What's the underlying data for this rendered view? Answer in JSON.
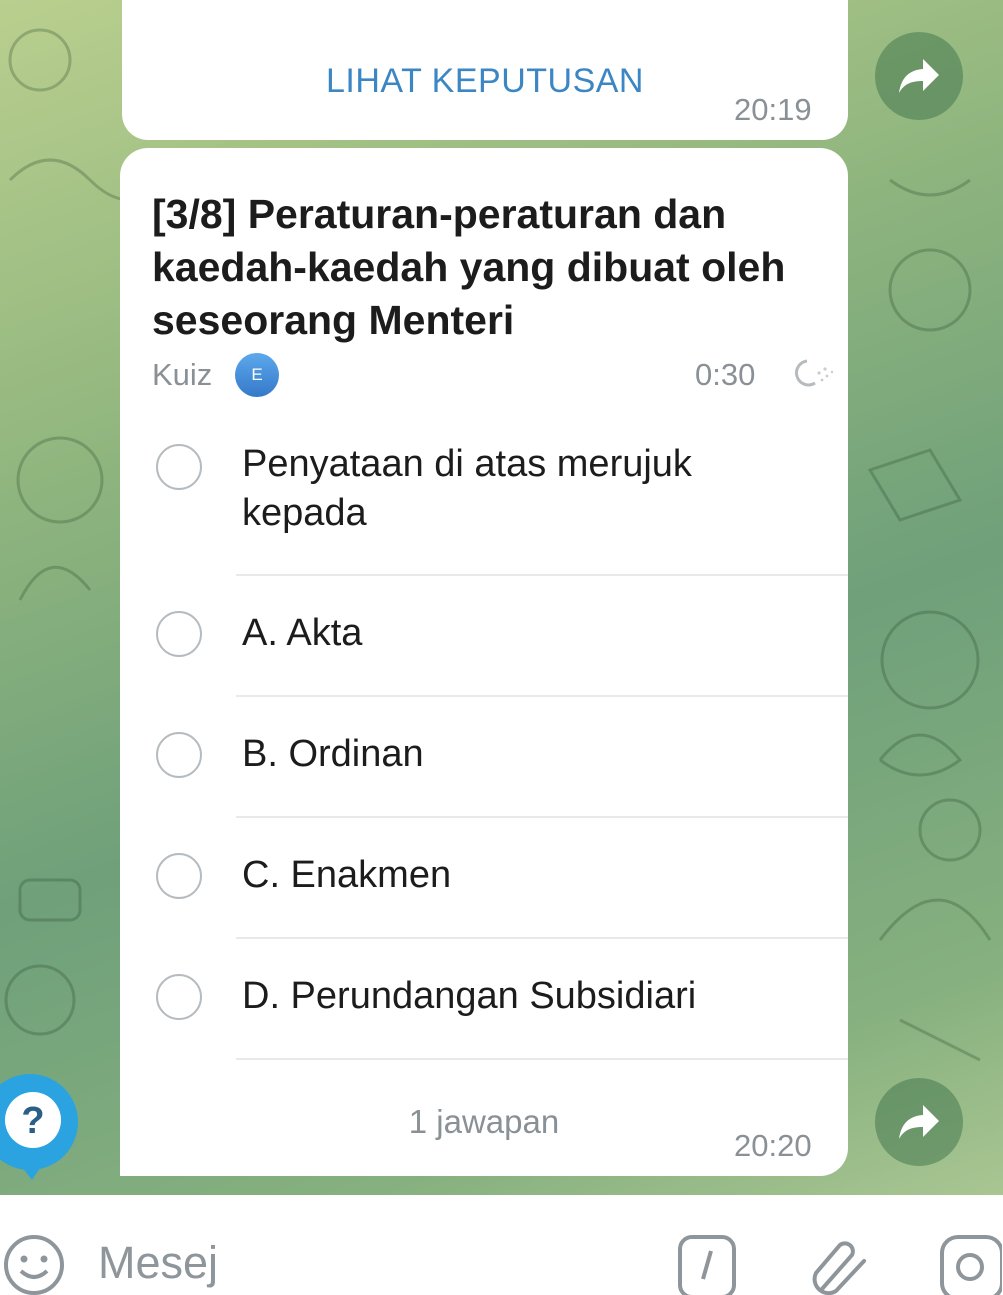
{
  "previous_message": {
    "action_label": "LIHAT KEPUTUSAN",
    "time": "20:19"
  },
  "poll": {
    "question": "[3/8] Peraturan-peraturan dan kaedah-kaedah yang dibuat oleh seseorang Menteri",
    "type_label": "Kuiz",
    "avatar_initial": "E",
    "timer": "0:30",
    "options": [
      {
        "label": "Penyataan di atas merujuk kepada"
      },
      {
        "label": "A. Akta"
      },
      {
        "label": "B. Ordinan"
      },
      {
        "label": "C. Enakmen"
      },
      {
        "label": "D. Perundangan Subsidiari"
      }
    ],
    "answers_count": "1 jawapan",
    "time": "20:20"
  },
  "icons": {
    "forward": "forward-arrow-icon",
    "help": "question-mark-icon",
    "emoji": "emoji-smile-icon",
    "commands": "slash-command-icon",
    "attach": "paperclip-icon",
    "camera": "camera-icon"
  },
  "input": {
    "placeholder": "Mesej"
  },
  "colors": {
    "accent": "#3c86c4",
    "avatar": "#3f8ad8",
    "help_button": "#2aa3e0"
  }
}
